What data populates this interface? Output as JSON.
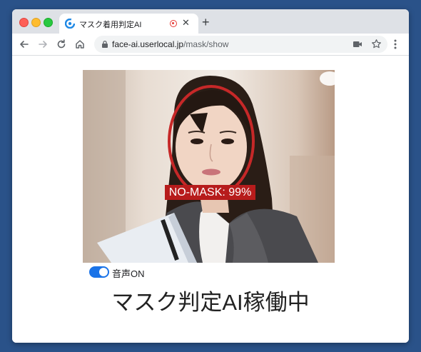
{
  "browser": {
    "tab": {
      "title": "マスク着用判定AI",
      "close": "✕"
    },
    "new_tab": "+",
    "url": {
      "domain": "face-ai.userlocal.jp",
      "path": "/mask/show"
    }
  },
  "detection": {
    "label": "NO-MASK: 99%",
    "color": "#c62828"
  },
  "voice_toggle": {
    "label": "音声ON",
    "on": true
  },
  "status_text": "マスク判定AI稼働中",
  "colors": {
    "accent": "#1a73e8",
    "window_bg": "#2a5289"
  }
}
